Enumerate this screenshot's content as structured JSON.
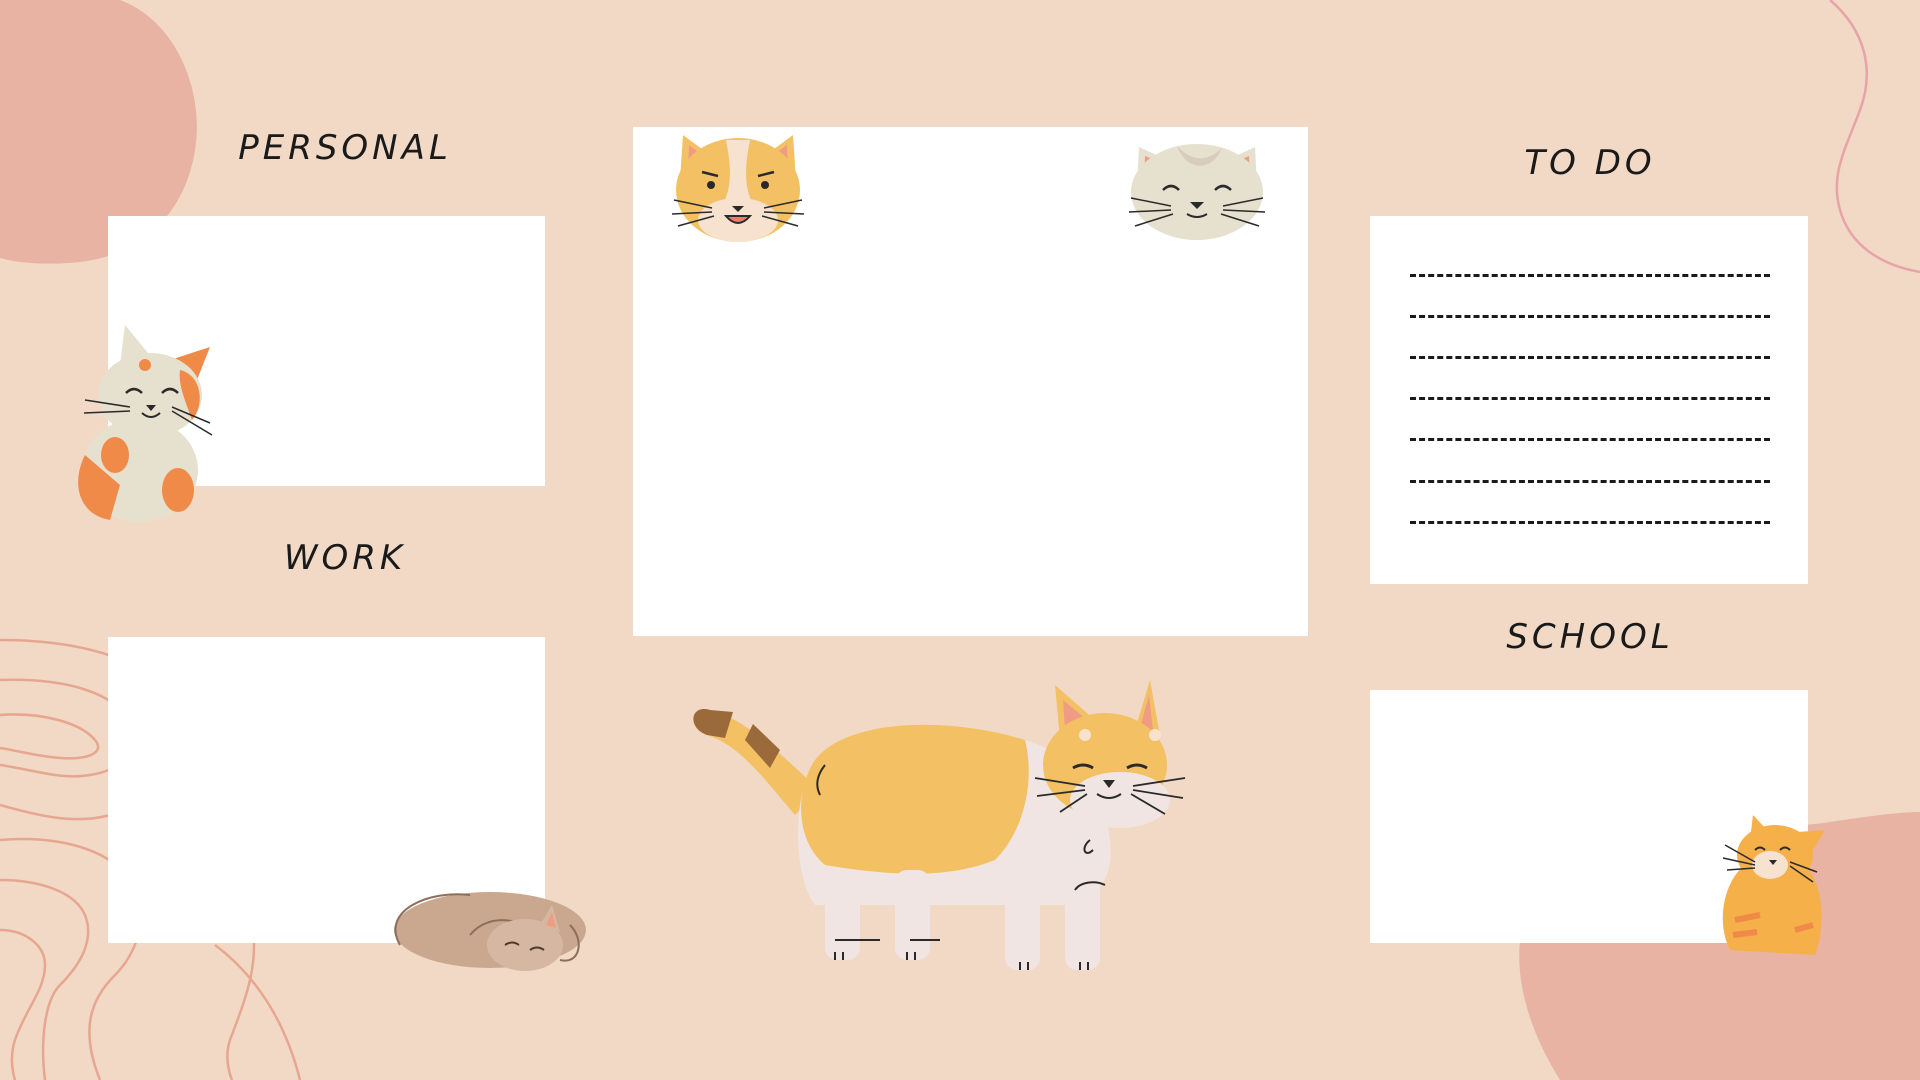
{
  "sections": {
    "personal": {
      "title": "PERSONAL"
    },
    "work": {
      "title": "WORK"
    },
    "todo": {
      "title": "TO DO",
      "line_count": 7
    },
    "school": {
      "title": "SCHOOL"
    }
  },
  "theme": {
    "background": "#f1d9c5",
    "blob": "#e8b3a2",
    "card": "#ffffff",
    "line": "#e8a898"
  },
  "decorations": [
    "blob-top-left",
    "blob-bottom-right",
    "squiggle-top-right",
    "contour-lines-bottom-left",
    "cat-face-orange-icon",
    "cat-face-gray-icon",
    "cat-waving-icon",
    "cat-sleeping-icon",
    "cat-walking-icon",
    "cat-sitting-icon"
  ]
}
